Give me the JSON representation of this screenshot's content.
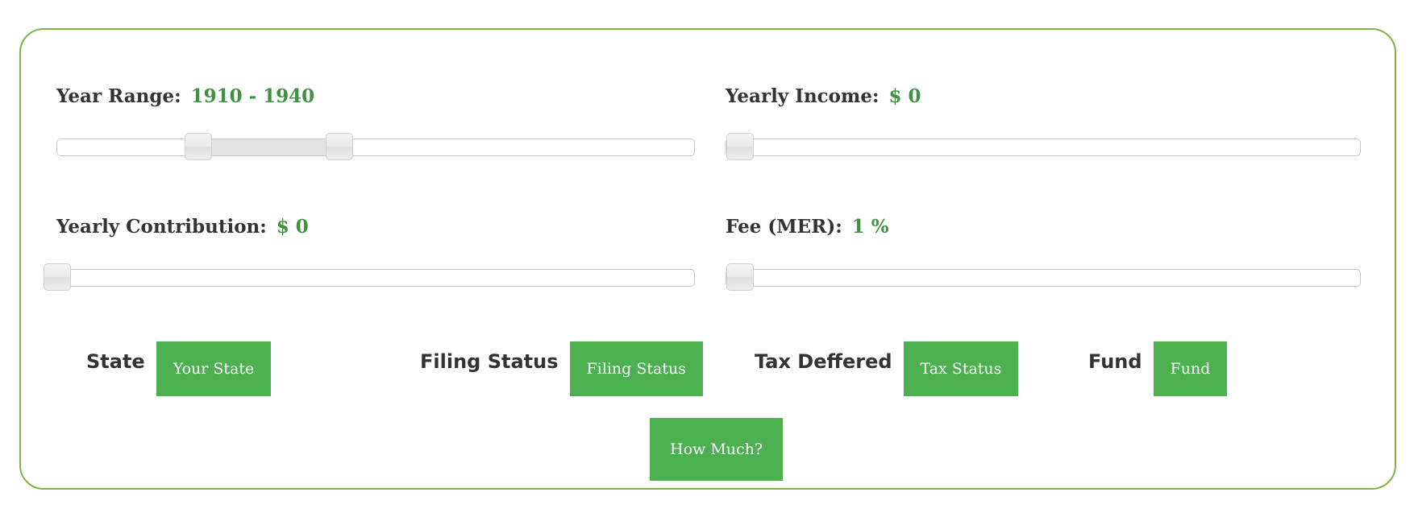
{
  "sliders": {
    "year_range": {
      "label": "Year Range:",
      "value_text": "1910 - 1940",
      "range": [
        1910,
        1940
      ],
      "low_fraction": 0.222,
      "high_fraction": 0.443
    },
    "yearly_income": {
      "label": "Yearly Income:",
      "value_text": "$ 0",
      "value": 0,
      "fraction": 0.0
    },
    "yearly_contribution": {
      "label": "Yearly Contribution:",
      "value_text": "$ 0",
      "value": 0,
      "fraction": 0.0
    },
    "fee": {
      "label": "Fee (MER):",
      "value_text": "1 %",
      "value": 1,
      "fraction": 0.0
    }
  },
  "selectors": {
    "state": {
      "label": "State",
      "button_label": "Your State"
    },
    "filing_status": {
      "label": "Filing Status",
      "button_label": "Filing Status"
    },
    "tax_deffered": {
      "label": "Tax Deffered",
      "button_label": "Tax Status"
    },
    "fund": {
      "label": "Fund",
      "button_label": "Fund"
    }
  },
  "actions": {
    "submit_label": "How Much?"
  },
  "colors": {
    "panel_border": "#7cb342",
    "value_text": "#3f9142",
    "button_bg": "#4caf50"
  }
}
